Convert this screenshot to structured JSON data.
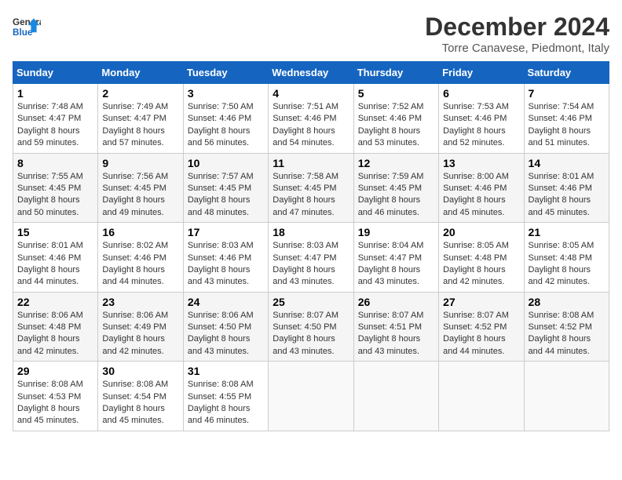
{
  "header": {
    "logo_line1": "General",
    "logo_line2": "Blue",
    "month": "December 2024",
    "location": "Torre Canavese, Piedmont, Italy"
  },
  "weekdays": [
    "Sunday",
    "Monday",
    "Tuesday",
    "Wednesday",
    "Thursday",
    "Friday",
    "Saturday"
  ],
  "weeks": [
    [
      {
        "day": "1",
        "sunrise": "Sunrise: 7:48 AM",
        "sunset": "Sunset: 4:47 PM",
        "daylight": "Daylight: 8 hours and 59 minutes."
      },
      {
        "day": "2",
        "sunrise": "Sunrise: 7:49 AM",
        "sunset": "Sunset: 4:47 PM",
        "daylight": "Daylight: 8 hours and 57 minutes."
      },
      {
        "day": "3",
        "sunrise": "Sunrise: 7:50 AM",
        "sunset": "Sunset: 4:46 PM",
        "daylight": "Daylight: 8 hours and 56 minutes."
      },
      {
        "day": "4",
        "sunrise": "Sunrise: 7:51 AM",
        "sunset": "Sunset: 4:46 PM",
        "daylight": "Daylight: 8 hours and 54 minutes."
      },
      {
        "day": "5",
        "sunrise": "Sunrise: 7:52 AM",
        "sunset": "Sunset: 4:46 PM",
        "daylight": "Daylight: 8 hours and 53 minutes."
      },
      {
        "day": "6",
        "sunrise": "Sunrise: 7:53 AM",
        "sunset": "Sunset: 4:46 PM",
        "daylight": "Daylight: 8 hours and 52 minutes."
      },
      {
        "day": "7",
        "sunrise": "Sunrise: 7:54 AM",
        "sunset": "Sunset: 4:46 PM",
        "daylight": "Daylight: 8 hours and 51 minutes."
      }
    ],
    [
      {
        "day": "8",
        "sunrise": "Sunrise: 7:55 AM",
        "sunset": "Sunset: 4:45 PM",
        "daylight": "Daylight: 8 hours and 50 minutes."
      },
      {
        "day": "9",
        "sunrise": "Sunrise: 7:56 AM",
        "sunset": "Sunset: 4:45 PM",
        "daylight": "Daylight: 8 hours and 49 minutes."
      },
      {
        "day": "10",
        "sunrise": "Sunrise: 7:57 AM",
        "sunset": "Sunset: 4:45 PM",
        "daylight": "Daylight: 8 hours and 48 minutes."
      },
      {
        "day": "11",
        "sunrise": "Sunrise: 7:58 AM",
        "sunset": "Sunset: 4:45 PM",
        "daylight": "Daylight: 8 hours and 47 minutes."
      },
      {
        "day": "12",
        "sunrise": "Sunrise: 7:59 AM",
        "sunset": "Sunset: 4:45 PM",
        "daylight": "Daylight: 8 hours and 46 minutes."
      },
      {
        "day": "13",
        "sunrise": "Sunrise: 8:00 AM",
        "sunset": "Sunset: 4:46 PM",
        "daylight": "Daylight: 8 hours and 45 minutes."
      },
      {
        "day": "14",
        "sunrise": "Sunrise: 8:01 AM",
        "sunset": "Sunset: 4:46 PM",
        "daylight": "Daylight: 8 hours and 45 minutes."
      }
    ],
    [
      {
        "day": "15",
        "sunrise": "Sunrise: 8:01 AM",
        "sunset": "Sunset: 4:46 PM",
        "daylight": "Daylight: 8 hours and 44 minutes."
      },
      {
        "day": "16",
        "sunrise": "Sunrise: 8:02 AM",
        "sunset": "Sunset: 4:46 PM",
        "daylight": "Daylight: 8 hours and 44 minutes."
      },
      {
        "day": "17",
        "sunrise": "Sunrise: 8:03 AM",
        "sunset": "Sunset: 4:46 PM",
        "daylight": "Daylight: 8 hours and 43 minutes."
      },
      {
        "day": "18",
        "sunrise": "Sunrise: 8:03 AM",
        "sunset": "Sunset: 4:47 PM",
        "daylight": "Daylight: 8 hours and 43 minutes."
      },
      {
        "day": "19",
        "sunrise": "Sunrise: 8:04 AM",
        "sunset": "Sunset: 4:47 PM",
        "daylight": "Daylight: 8 hours and 43 minutes."
      },
      {
        "day": "20",
        "sunrise": "Sunrise: 8:05 AM",
        "sunset": "Sunset: 4:48 PM",
        "daylight": "Daylight: 8 hours and 42 minutes."
      },
      {
        "day": "21",
        "sunrise": "Sunrise: 8:05 AM",
        "sunset": "Sunset: 4:48 PM",
        "daylight": "Daylight: 8 hours and 42 minutes."
      }
    ],
    [
      {
        "day": "22",
        "sunrise": "Sunrise: 8:06 AM",
        "sunset": "Sunset: 4:48 PM",
        "daylight": "Daylight: 8 hours and 42 minutes."
      },
      {
        "day": "23",
        "sunrise": "Sunrise: 8:06 AM",
        "sunset": "Sunset: 4:49 PM",
        "daylight": "Daylight: 8 hours and 42 minutes."
      },
      {
        "day": "24",
        "sunrise": "Sunrise: 8:06 AM",
        "sunset": "Sunset: 4:50 PM",
        "daylight": "Daylight: 8 hours and 43 minutes."
      },
      {
        "day": "25",
        "sunrise": "Sunrise: 8:07 AM",
        "sunset": "Sunset: 4:50 PM",
        "daylight": "Daylight: 8 hours and 43 minutes."
      },
      {
        "day": "26",
        "sunrise": "Sunrise: 8:07 AM",
        "sunset": "Sunset: 4:51 PM",
        "daylight": "Daylight: 8 hours and 43 minutes."
      },
      {
        "day": "27",
        "sunrise": "Sunrise: 8:07 AM",
        "sunset": "Sunset: 4:52 PM",
        "daylight": "Daylight: 8 hours and 44 minutes."
      },
      {
        "day": "28",
        "sunrise": "Sunrise: 8:08 AM",
        "sunset": "Sunset: 4:52 PM",
        "daylight": "Daylight: 8 hours and 44 minutes."
      }
    ],
    [
      {
        "day": "29",
        "sunrise": "Sunrise: 8:08 AM",
        "sunset": "Sunset: 4:53 PM",
        "daylight": "Daylight: 8 hours and 45 minutes."
      },
      {
        "day": "30",
        "sunrise": "Sunrise: 8:08 AM",
        "sunset": "Sunset: 4:54 PM",
        "daylight": "Daylight: 8 hours and 45 minutes."
      },
      {
        "day": "31",
        "sunrise": "Sunrise: 8:08 AM",
        "sunset": "Sunset: 4:55 PM",
        "daylight": "Daylight: 8 hours and 46 minutes."
      },
      null,
      null,
      null,
      null
    ]
  ]
}
